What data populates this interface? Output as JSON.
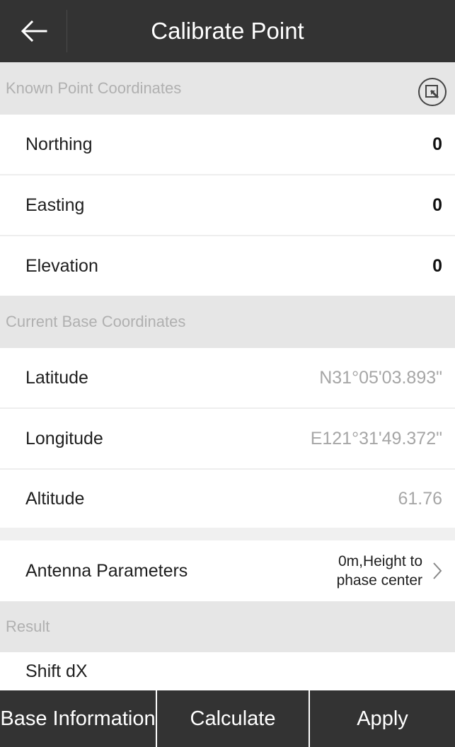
{
  "header": {
    "title": "Calibrate Point",
    "back_icon": "arrow-left-icon"
  },
  "known_section": {
    "label": "Known Point Coordinates",
    "import_icon": "import-point-icon"
  },
  "known_rows": [
    {
      "label": "Northing",
      "value": "0"
    },
    {
      "label": "Easting",
      "value": "0"
    },
    {
      "label": "Elevation",
      "value": "0"
    }
  ],
  "base_section": {
    "label": "Current Base Coordinates"
  },
  "base_rows": [
    {
      "label": "Latitude",
      "value": "N31°05'03.893\""
    },
    {
      "label": "Longitude",
      "value": "E121°31'49.372\""
    },
    {
      "label": "Altitude",
      "value": "61.76"
    }
  ],
  "antenna": {
    "label": "Antenna Parameters",
    "value": "0m,Height to phase center",
    "chevron_icon": "chevron-right-icon"
  },
  "result_section": {
    "label": "Result"
  },
  "result_rows": [
    {
      "label": "Shift dX"
    }
  ],
  "bottom_bar": {
    "base_info": "Base Information",
    "calculate": "Calculate",
    "apply": "Apply"
  }
}
